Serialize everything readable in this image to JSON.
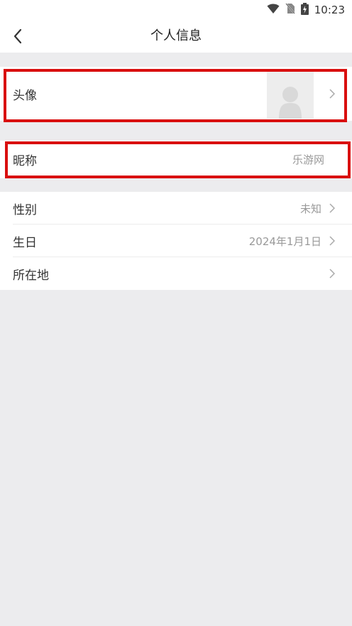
{
  "status_bar": {
    "time": "10:23",
    "icons": [
      "wifi-icon",
      "no-sim-icon",
      "battery-charging-icon"
    ]
  },
  "header": {
    "title": "个人信息",
    "back_icon": "chevron-left-icon"
  },
  "rows": {
    "avatar": {
      "label": "头像"
    },
    "nickname": {
      "label": "昵称",
      "value": "乐游网"
    },
    "gender": {
      "label": "性别",
      "value": "未知"
    },
    "birthday": {
      "label": "生日",
      "value": "2024年1月1日"
    },
    "location": {
      "label": "所在地",
      "value": ""
    }
  },
  "colors": {
    "highlight": "#d90f0f",
    "background": "#ececee",
    "row_bg": "#ffffff"
  }
}
